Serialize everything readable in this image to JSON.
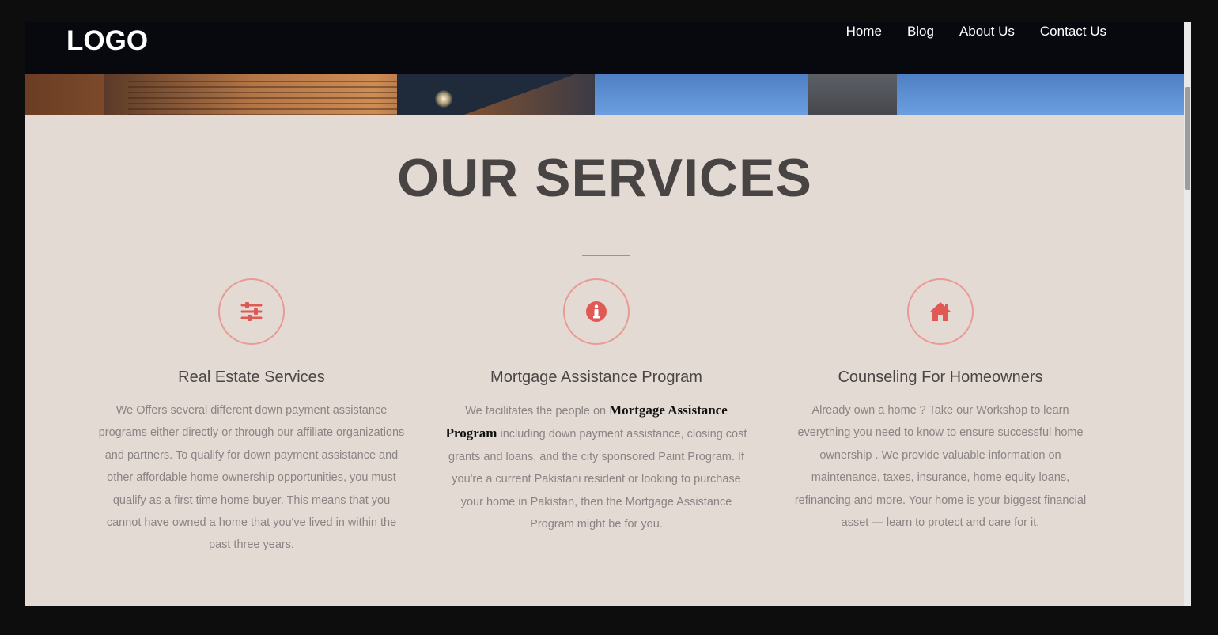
{
  "header": {
    "logo": "LOGO",
    "nav": [
      "Home",
      "Blog",
      "About Us",
      "Contact Us"
    ]
  },
  "services": {
    "title": "OUR SERVICES",
    "items": [
      {
        "icon": "sliders-icon",
        "title": "Real Estate Services",
        "text": "We Offers several different down payment assistance programs either directly or through our affiliate organizations and partners. To qualify for down payment assistance and other affordable home ownership opportunities, you must qualify as a first time home buyer. This means that you cannot have owned a home that you've lived in within the past three years."
      },
      {
        "icon": "info-icon",
        "title": "Mortgage Assistance Program",
        "text_before": "We facilitates the people on ",
        "text_bold": "Mortgage Assistance Program",
        "text_after": " including down payment assistance, closing cost grants and loans, and the city sponsored Paint Program. If you're a current Pakistani resident or looking to purchase your home in Pakistan, then the  Mortgage Assistance Program might be for you."
      },
      {
        "icon": "home-icon",
        "title": "Counseling For Homeowners",
        "text": "Already own a home ? Take our  Workshop to learn everything you need to know to ensure successful home ownership . We provide valuable information on maintenance, taxes, insurance, home equity loans, refinancing and more. Your home is your biggest financial asset — learn to protect and care for it."
      }
    ]
  },
  "colors": {
    "accent": "#df5a55",
    "background": "#e3dad4",
    "navbar": "#07090e"
  }
}
